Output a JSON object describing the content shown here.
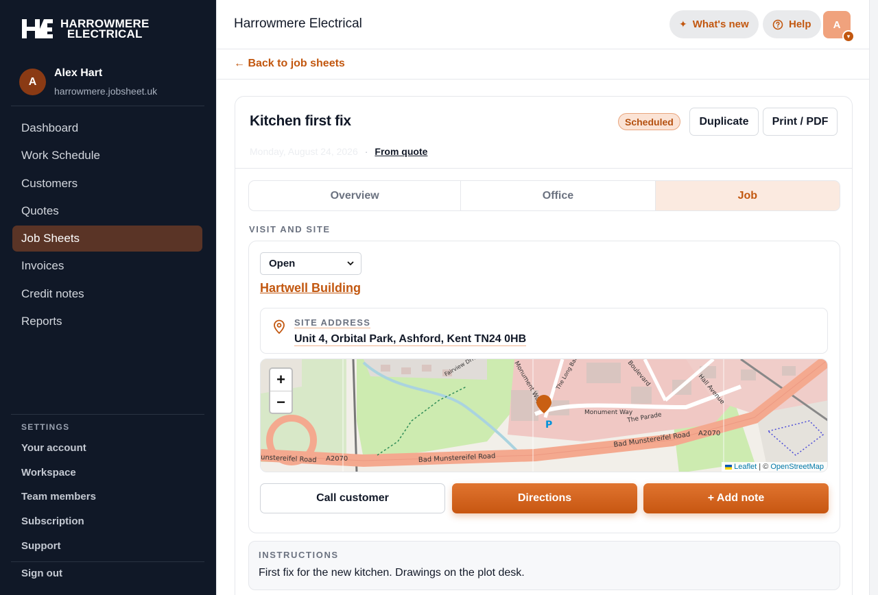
{
  "brand": {
    "line1": "HARROWMERE",
    "line2": "ELECTRICAL"
  },
  "user": {
    "initial": "A",
    "name": "Alex Hart",
    "domain": "harrowmere.jobsheet.uk"
  },
  "nav": {
    "items": [
      {
        "label": "Dashboard"
      },
      {
        "label": "Work Schedule"
      },
      {
        "label": "Customers"
      },
      {
        "label": "Quotes"
      },
      {
        "label": "Job Sheets"
      },
      {
        "label": "Invoices"
      },
      {
        "label": "Credit notes"
      },
      {
        "label": "Reports"
      }
    ],
    "active": "Job Sheets"
  },
  "settings": {
    "heading": "SETTINGS",
    "items": [
      {
        "label": "Your account"
      },
      {
        "label": "Workspace"
      },
      {
        "label": "Team members"
      },
      {
        "label": "Subscription"
      },
      {
        "label": "Support"
      }
    ],
    "signout": "Sign out"
  },
  "topbar": {
    "title": "Harrowmere Electrical",
    "whats_new": "What's new",
    "help": "Help",
    "avatar_initial": "A"
  },
  "back_link": "← Back to job sheets",
  "job": {
    "title": "Kitchen first fix",
    "status": "Scheduled",
    "duplicate": "Duplicate",
    "print": "Print / PDF",
    "meta_faded": "Monday, August 24, 2026",
    "meta_sep": "·",
    "from_quote": "From quote"
  },
  "tabs": [
    {
      "label": "Overview"
    },
    {
      "label": "Office"
    },
    {
      "label": "Job"
    }
  ],
  "active_tab": "Job",
  "visit": {
    "section_label": "VISIT AND SITE",
    "status_select": "Open",
    "site_name": "Hartwell Building",
    "address_label": "SITE ADDRESS",
    "address": "Unit 4, Orbital Park, Ashford, Kent TN24 0HB"
  },
  "map": {
    "zoom_in": "+",
    "zoom_out": "−",
    "attribution_leaflet": "Leaflet",
    "attribution_sep": "| ©",
    "attribution_osm": "OpenStreetMap",
    "labels": {
      "road1": "Bad Munstereifel Road",
      "road2": "Bad Munstereifel Road",
      "road3": "unstereifel Road",
      "a2070a": "A2070",
      "a2070b": "A2070",
      "monument_way": "Monument Way",
      "monument_way2": "Monument Way",
      "the_parade": "The Parade",
      "boulevard": "Boulevard",
      "hall_avenue": "Hall Avenue",
      "fairview": "Fairview Drive",
      "long_barn": "The Long Barn",
      "parking": "P"
    }
  },
  "actions": {
    "call": "Call customer",
    "directions": "Directions",
    "add_note": "+ Add note"
  },
  "instructions": {
    "label": "INSTRUCTIONS",
    "text": "First fix for the new kitchen. Drawings on the plot desk."
  },
  "colors": {
    "accent": "#c2570f",
    "sidebar_bg": "#101827",
    "sidebar_active": "#5a3426"
  }
}
